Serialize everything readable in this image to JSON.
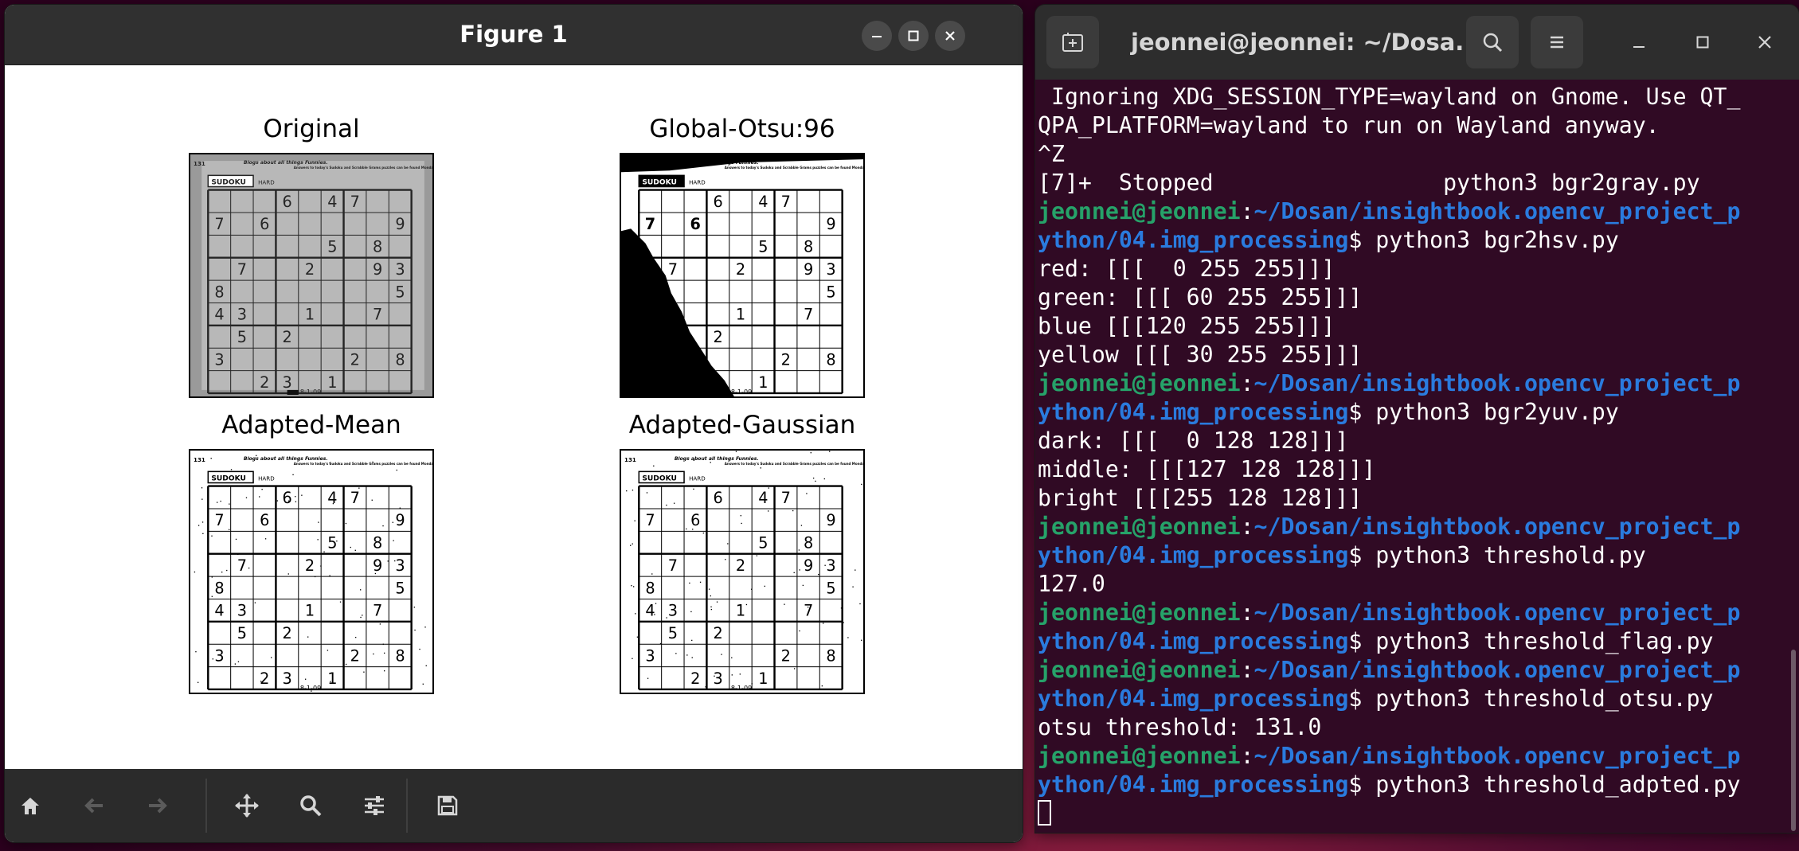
{
  "figure_window": {
    "title": "Figure 1",
    "controls": {
      "minimize": "–",
      "maximize": "☐",
      "close": "✕"
    },
    "subplots": [
      {
        "title": "Original",
        "style": "gray"
      },
      {
        "title": "Global-Otsu:96",
        "style": "otsu"
      },
      {
        "title": "Adapted-Mean",
        "style": "binary"
      },
      {
        "title": "Adapted-Gaussian",
        "style": "binary"
      }
    ],
    "sudoku": {
      "grid": [
        [
          0,
          0,
          0,
          6,
          0,
          4,
          7,
          0,
          0
        ],
        [
          7,
          0,
          6,
          0,
          0,
          0,
          0,
          0,
          9
        ],
        [
          0,
          0,
          0,
          0,
          0,
          5,
          0,
          8,
          0
        ],
        [
          0,
          7,
          0,
          0,
          2,
          0,
          0,
          9,
          3
        ],
        [
          8,
          0,
          0,
          0,
          0,
          0,
          0,
          0,
          5
        ],
        [
          4,
          3,
          0,
          0,
          1,
          0,
          0,
          7,
          0
        ],
        [
          0,
          5,
          0,
          2,
          0,
          0,
          0,
          0,
          0
        ],
        [
          3,
          0,
          0,
          0,
          0,
          0,
          2,
          0,
          8
        ],
        [
          0,
          0,
          2,
          3,
          0,
          1,
          0,
          0,
          0
        ]
      ],
      "header_label": "SUDOKU",
      "difficulty": "HARD",
      "footer_text": "8-1-09",
      "corner_number": "131",
      "ad_text": "Blogs about all things Funnies.",
      "answers_text": "Answers to today's Sudoku and Scrabble Grams puzzles can be found Monday on the preceding page."
    },
    "toolbar": [
      "home-icon",
      "back-icon",
      "forward-icon",
      "pan-icon",
      "zoom-icon",
      "configure-icon",
      "save-icon"
    ]
  },
  "terminal": {
    "title": "jeonnei@jeonnei: ~/Dosa...",
    "user": "jeonnei@jeonnei",
    "lines": [
      {
        "type": "text",
        "text": " Ignoring XDG_SESSION_TYPE=wayland on Gnome. Use QT_"
      },
      {
        "type": "text",
        "text": "QPA_PLATFORM=wayland to run on Wayland anyway."
      },
      {
        "type": "text",
        "text": "^Z"
      },
      {
        "type": "text",
        "text": "[7]+  Stopped                 python3 bgr2gray.py"
      },
      {
        "type": "prompt1"
      },
      {
        "type": "prompt2",
        "cmd": "python3 bgr2hsv.py"
      },
      {
        "type": "text",
        "text": "red: [[[  0 255 255]]]"
      },
      {
        "type": "text",
        "text": "green: [[[ 60 255 255]]]"
      },
      {
        "type": "text",
        "text": "blue [[[120 255 255]]]"
      },
      {
        "type": "text",
        "text": "yellow [[[ 30 255 255]]]"
      },
      {
        "type": "prompt1"
      },
      {
        "type": "prompt2",
        "cmd": "python3 bgr2yuv.py"
      },
      {
        "type": "text",
        "text": "dark: [[[  0 128 128]]]"
      },
      {
        "type": "text",
        "text": "middle: [[[127 128 128]]]"
      },
      {
        "type": "text",
        "text": "bright [[[255 128 128]]]"
      },
      {
        "type": "prompt1"
      },
      {
        "type": "prompt2",
        "cmd": "python3 threshold.py"
      },
      {
        "type": "text",
        "text": "127.0"
      },
      {
        "type": "prompt1"
      },
      {
        "type": "prompt2",
        "cmd": "python3 threshold_flag.py"
      },
      {
        "type": "prompt1"
      },
      {
        "type": "prompt2",
        "cmd": "python3 threshold_otsu.py"
      },
      {
        "type": "text",
        "text": "otsu threshold: 131.0"
      },
      {
        "type": "prompt1"
      },
      {
        "type": "prompt2",
        "cmd": "python3 threshold_adpted.py"
      },
      {
        "type": "cursor"
      }
    ],
    "path_part1": "~/Dosan/insightbook.opencv_project_p",
    "path_part2": "ython/04.img_processing",
    "colors": {
      "user": "#26a269",
      "path": "#2a7bde",
      "background": "#300a24"
    }
  }
}
